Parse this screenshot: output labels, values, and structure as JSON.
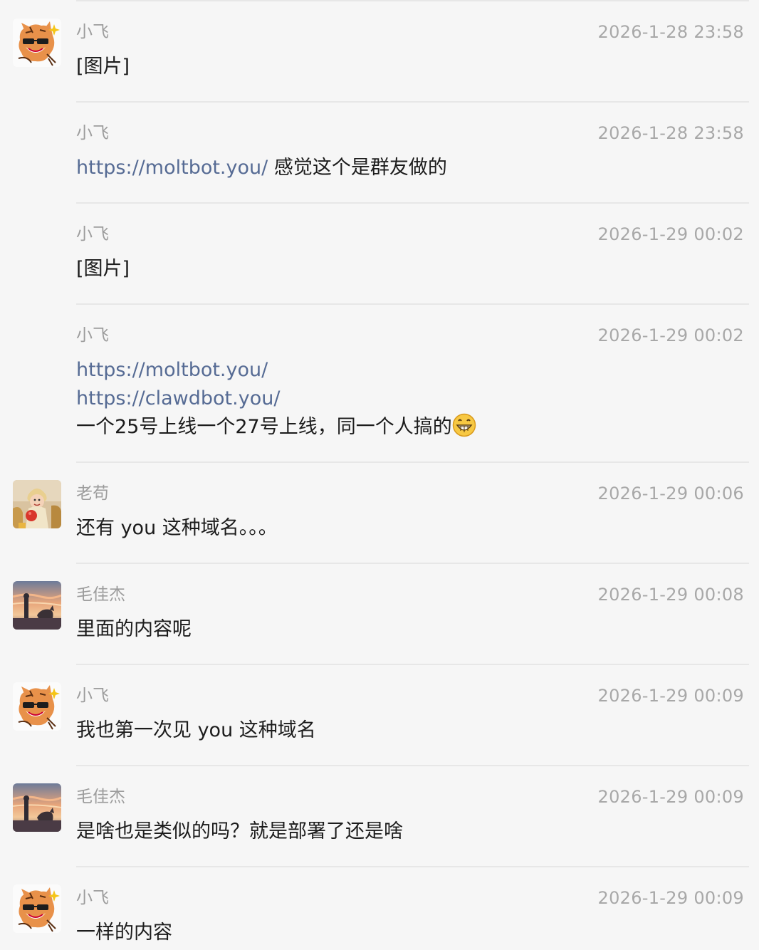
{
  "messages": [
    {
      "sender": "小飞",
      "time": "2026-1-28 23:58",
      "text": "[图片]",
      "avatar": "tiger-avatar"
    },
    {
      "sender": "小飞",
      "time": "2026-1-28 23:58",
      "link": "https://moltbot.you/",
      "text": "感觉这个是群友做的"
    },
    {
      "sender": "小飞",
      "time": "2026-1-29 00:02",
      "text": "[图片]"
    },
    {
      "sender": "小飞",
      "time": "2026-1-29 00:02",
      "link1": "https://moltbot.you/",
      "link2": "https://clawdbot.you/",
      "text": "一个25号上线一个27号上线，同一个人搞的",
      "emoji": "grinning-face-emoji"
    },
    {
      "sender": "老苟",
      "time": "2026-1-29 00:06",
      "text": "还有 you 这种域名。。。",
      "avatar": "child-photo-avatar"
    },
    {
      "sender": "毛佳杰",
      "time": "2026-1-29 00:08",
      "text": "里面的内容呢",
      "avatar": "sunset-dog-avatar"
    },
    {
      "sender": "小飞",
      "time": "2026-1-29 00:09",
      "text": "我也第一次见 you 这种域名",
      "avatar": "tiger-avatar"
    },
    {
      "sender": "毛佳杰",
      "time": "2026-1-29 00:09",
      "text": "是啥也是类似的吗？就是部署了还是啥",
      "avatar": "sunset-dog-avatar"
    },
    {
      "sender": "小飞",
      "time": "2026-1-29 00:09",
      "text": "一样的内容",
      "avatar": "tiger-avatar"
    }
  ],
  "colors": {
    "background": "#f6f6f6",
    "link": "#566b94",
    "sender": "#9c9c9c",
    "time": "#a8a8a8",
    "divider": "#e7e7e7"
  }
}
